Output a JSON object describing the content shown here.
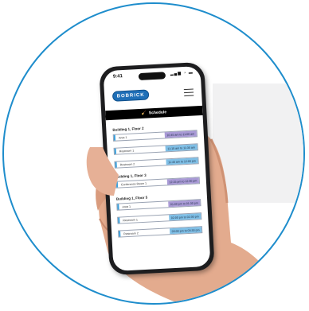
{
  "status_bar": {
    "time": "9:41",
    "icons": "▂▄▆ ◔ ▬"
  },
  "header": {
    "logo_text": "BOBRICK"
  },
  "schedule_bar": {
    "label": "Schedule"
  },
  "sections": [
    {
      "title": "Building 1, Floor 2",
      "rows": [
        {
          "name": "Area 1",
          "time": "10:45 am to 11:00 am"
        },
        {
          "name": "Restroom 1",
          "time": "11:15 am to 11:30 am"
        },
        {
          "name": "Restroom 2",
          "time": "11:45 am to 12:00 pm"
        }
      ]
    },
    {
      "title": "Building 1, Floor 3",
      "rows": [
        {
          "name": "Conference Room 1",
          "time": "12:15 pm to 12:30 pm"
        }
      ]
    },
    {
      "title": "Building 1, Floor 5",
      "rows": [
        {
          "name": "Area 1",
          "time": "01:00 pm to 01:30 pm"
        },
        {
          "name": "Restroom 1",
          "time": "02:00 pm to 02:30 pm"
        },
        {
          "name": "Restroom 2",
          "time": "03:00 pm to 03:30 pm"
        }
      ]
    }
  ],
  "colors": {
    "ring": "#1e8dcc",
    "logo": "#1f6fb7",
    "purple": "#a99ad6",
    "blue": "#7fbfe6"
  }
}
